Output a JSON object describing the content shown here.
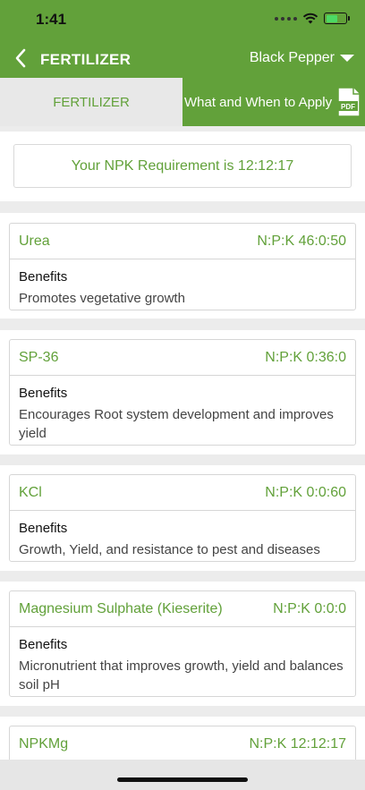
{
  "status": {
    "time": "1:41"
  },
  "nav": {
    "title": "FERTILIZER",
    "crop": "Black Pepper"
  },
  "tabs": {
    "fertilizer": "FERTILIZER",
    "apply": "What and When to Apply",
    "pdf": "PDF"
  },
  "requirement": "Your NPK Requirement is 12:12:17",
  "cards": [
    {
      "name": "Urea",
      "npk": "N:P:K 46:0:50",
      "benefits_label": "Benefits",
      "benefits": "Promotes vegetative growth"
    },
    {
      "name": "SP-36",
      "npk": "N:P:K 0:36:0",
      "benefits_label": "Benefits",
      "benefits": "Encourages Root system development and improves yield"
    },
    {
      "name": "KCl",
      "npk": "N:P:K 0:0:60",
      "benefits_label": "Benefits",
      "benefits": "Growth, Yield, and resistance to pest and diseases"
    },
    {
      "name": "Magnesium Sulphate (Kieserite)",
      "npk": "N:P:K 0:0:0",
      "benefits_label": "Benefits",
      "benefits": "Micronutrient that improves growth, yield and balances soil pH"
    },
    {
      "name": "NPKMg",
      "npk": "N:P:K 12:12:17"
    }
  ],
  "colors": {
    "primary": "#62a13a",
    "background": "#ececec",
    "card_border": "#d6d6d6"
  }
}
